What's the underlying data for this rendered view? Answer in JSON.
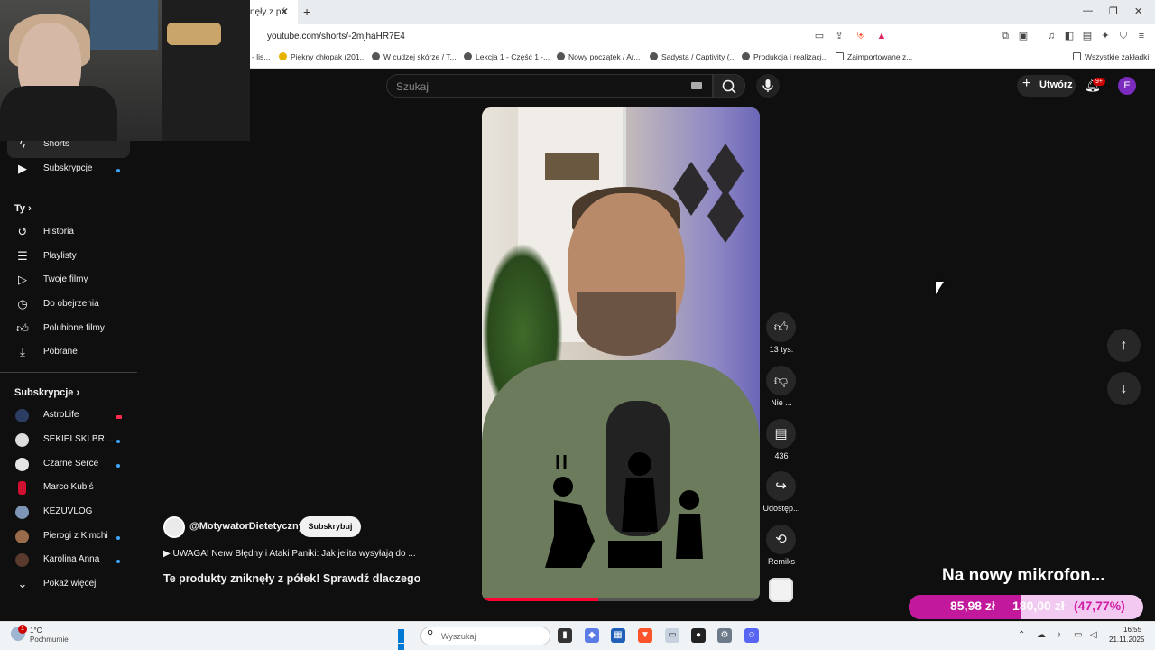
{
  "browser": {
    "tab_title": "nęły z pó",
    "url": "youtube.com/shorts/-2mjhaHR7E4",
    "bookmarks": [
      "- lis...",
      "Piękny chłopak (201...",
      "W cudzej skórze / T...",
      "Lekcja 1 - Część 1 -...",
      "Nowy początek / Ar...",
      "Sadysta / Captivity (...",
      "Produkcja i realizacj...",
      "Zaimportowane z...",
      "Wszystkie zakładki"
    ]
  },
  "header": {
    "search_placeholder": "Szukaj",
    "create_label": "Utwórz",
    "notifications_badge": "9+",
    "avatar_letter": "E"
  },
  "sidebar": {
    "shorts": "Shorts",
    "subscriptions": "Subskrypcje",
    "you_heading": "Ty",
    "you_items": [
      "Historia",
      "Playlisty",
      "Twoje filmy",
      "Do obejrzenia",
      "Polubione filmy",
      "Pobrane"
    ],
    "subs_heading": "Subskrypcje",
    "channels": [
      "AstroLife",
      "SEKIELSKI BROT...",
      "Czarne Serce",
      "Marco Kubiś",
      "KEZUVLOG",
      "Pierogi z Kimchi",
      "Karolina Anna"
    ],
    "show_more": "Pokaż więcej"
  },
  "short": {
    "channel": "@MotywatorDietetyczny",
    "subscribe": "Subskrybuj",
    "description": "▶ UWAGA! Nerw Błędny i Ataki Paniki: Jak jelita wysyłają do ...",
    "title": "Te produkty zniknęły z półek! Sprawdź dlaczego",
    "likes": "13 tys.",
    "dislike": "Nie ...",
    "comments": "436",
    "share": "Udostęp...",
    "remix": "Remiks",
    "progress": 0.42
  },
  "overlay": {
    "goal_title": "Na nowy mikrofon...",
    "current": "85,98 zł",
    "target": "180,00 zł",
    "percent": "(47,77%)",
    "fraction": 0.4777
  },
  "taskbar": {
    "weather_badge": "1",
    "temperature": "1°C",
    "condition": "Pochmurnie",
    "search_placeholder": "Wyszukaj",
    "time": "16:55",
    "date": "21.11.2025"
  },
  "colors": {
    "accent_red": "#ff0033",
    "goal_fill": "#c2189b",
    "goal_bg": "#f2c9f0"
  }
}
